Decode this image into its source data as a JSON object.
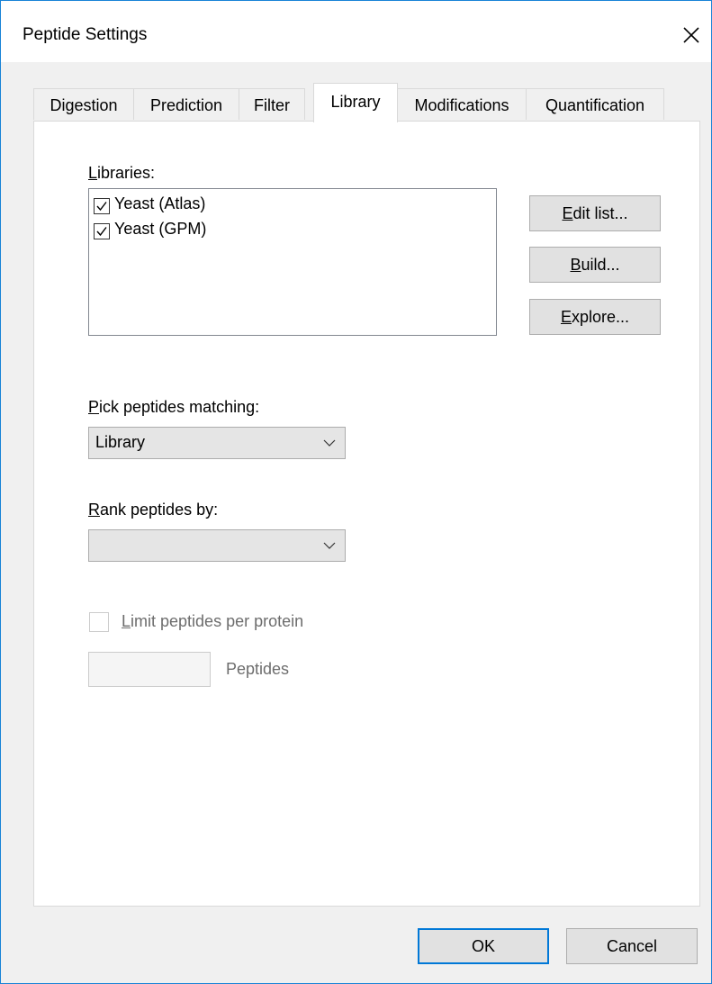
{
  "window": {
    "title": "Peptide Settings"
  },
  "tabs": [
    {
      "label": "Digestion",
      "active": false
    },
    {
      "label": "Prediction",
      "active": false
    },
    {
      "label": "Filter",
      "active": false
    },
    {
      "label": "Library",
      "active": true
    },
    {
      "label": "Modifications",
      "active": false
    },
    {
      "label": "Quantification",
      "active": false
    }
  ],
  "libraries": {
    "label_prefix": "L",
    "label_rest": "ibraries:",
    "items": [
      {
        "label": "Yeast (Atlas)",
        "checked": true
      },
      {
        "label": "Yeast (GPM)",
        "checked": true
      }
    ]
  },
  "buttons": {
    "edit_list": {
      "u": "E",
      "rest": "dit list..."
    },
    "build": {
      "u": "B",
      "rest": "uild..."
    },
    "explore": {
      "u": "E",
      "rest": "xplore..."
    },
    "ok": "OK",
    "cancel": "Cancel"
  },
  "pick": {
    "label_u": "P",
    "label_rest": "ick peptides matching:",
    "value": "Library"
  },
  "rank": {
    "label_u": "R",
    "label_rest": "ank peptides by:",
    "value": ""
  },
  "limit": {
    "label_u": "L",
    "label_rest": "imit peptides per protein",
    "checked": false,
    "enabled": false,
    "value": "",
    "unit": "Peptides"
  },
  "colors": {
    "window_border": "#1883d7",
    "primary_button_border": "#0078d7"
  }
}
